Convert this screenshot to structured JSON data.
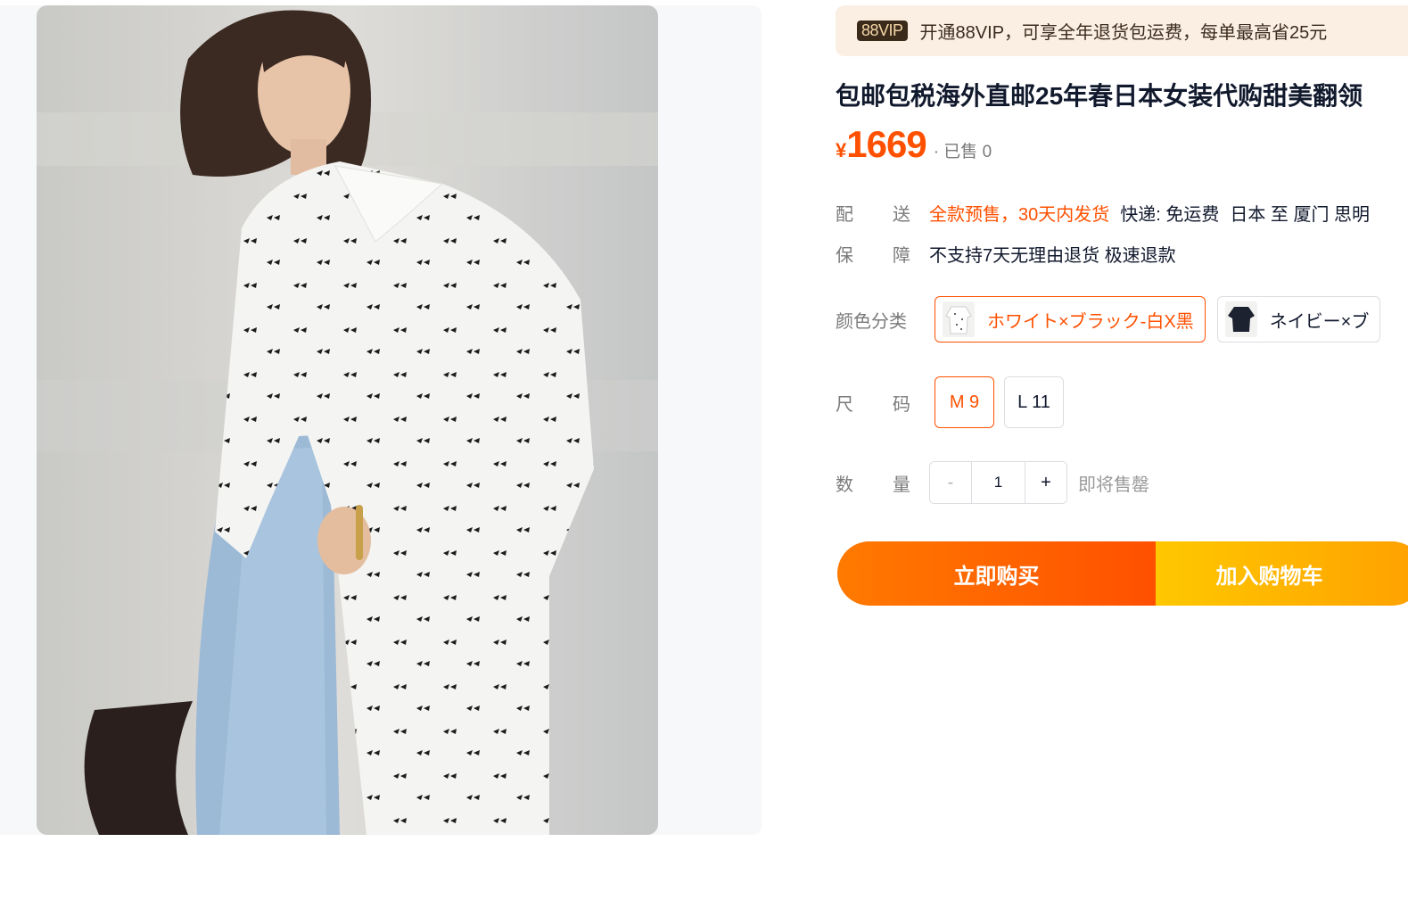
{
  "vip": {
    "badge": "88VIP",
    "text": "开通88VIP，可享全年退货包运费，每单最高省25元"
  },
  "product": {
    "title": "包邮包税海外直邮25年春日本女装代购甜美翻领",
    "currency": "¥",
    "price": "1669",
    "sold": "· 已售 0"
  },
  "shipping": {
    "label_a": "配",
    "label_b": "送",
    "presale": "全款预售，30天内发货",
    "express": "快递: 免运费",
    "route": "日本 至 厦门 思明"
  },
  "guarantee": {
    "label_a": "保",
    "label_b": "障",
    "text": "不支持7天无理由退货 极速退款"
  },
  "color": {
    "label": "颜色分类",
    "options": [
      {
        "label": "ホワイト×ブラック-白X黑",
        "selected": true
      },
      {
        "label": "ネイビー×ブ",
        "selected": false
      }
    ]
  },
  "size": {
    "label_a": "尺",
    "label_b": "码",
    "options": [
      {
        "label": "M 9",
        "selected": true
      },
      {
        "label": "L 11",
        "selected": false
      }
    ]
  },
  "quantity": {
    "label_a": "数",
    "label_b": "量",
    "minus": "-",
    "value": "1",
    "plus": "+",
    "note": "即将售罄"
  },
  "actions": {
    "buy_now": "立即购买",
    "add_to_cart": "加入购物车"
  },
  "colors": {
    "accent": "#ff5000",
    "vip_bg": "#fbefe3",
    "cart_yellow": "#ffc800"
  }
}
